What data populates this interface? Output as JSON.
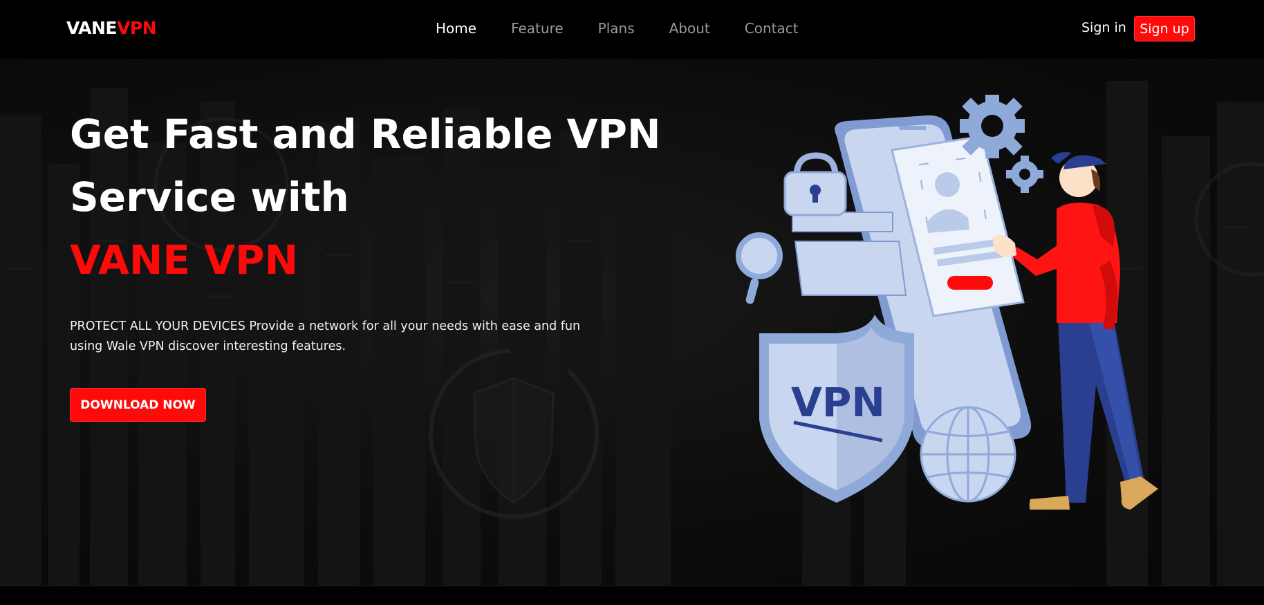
{
  "nav": {
    "logo_part1": "VANE",
    "logo_part2": "VPN",
    "links": [
      {
        "label": "Home"
      },
      {
        "label": "Feature"
      },
      {
        "label": "Plans"
      },
      {
        "label": "About"
      },
      {
        "label": "Contact"
      }
    ],
    "sign_in": "Sign in",
    "sign_up": "Sign up"
  },
  "hero": {
    "title_line1": "Get Fast and Reliable VPN",
    "title_line2": "Service with",
    "title_brand": "VANE VPN",
    "description": "PROTECT ALL YOUR DEVICES Provide a network for all your needs with ease and fun using Wale VPN discover interesting features.",
    "cta": "DOWNLOAD NOW",
    "shield_text": "VPN"
  },
  "colors": {
    "accent": "#ff0a0a",
    "background": "#000000",
    "illustration_blue": "#8fa9d9",
    "illustration_navy": "#2a3f8f"
  }
}
